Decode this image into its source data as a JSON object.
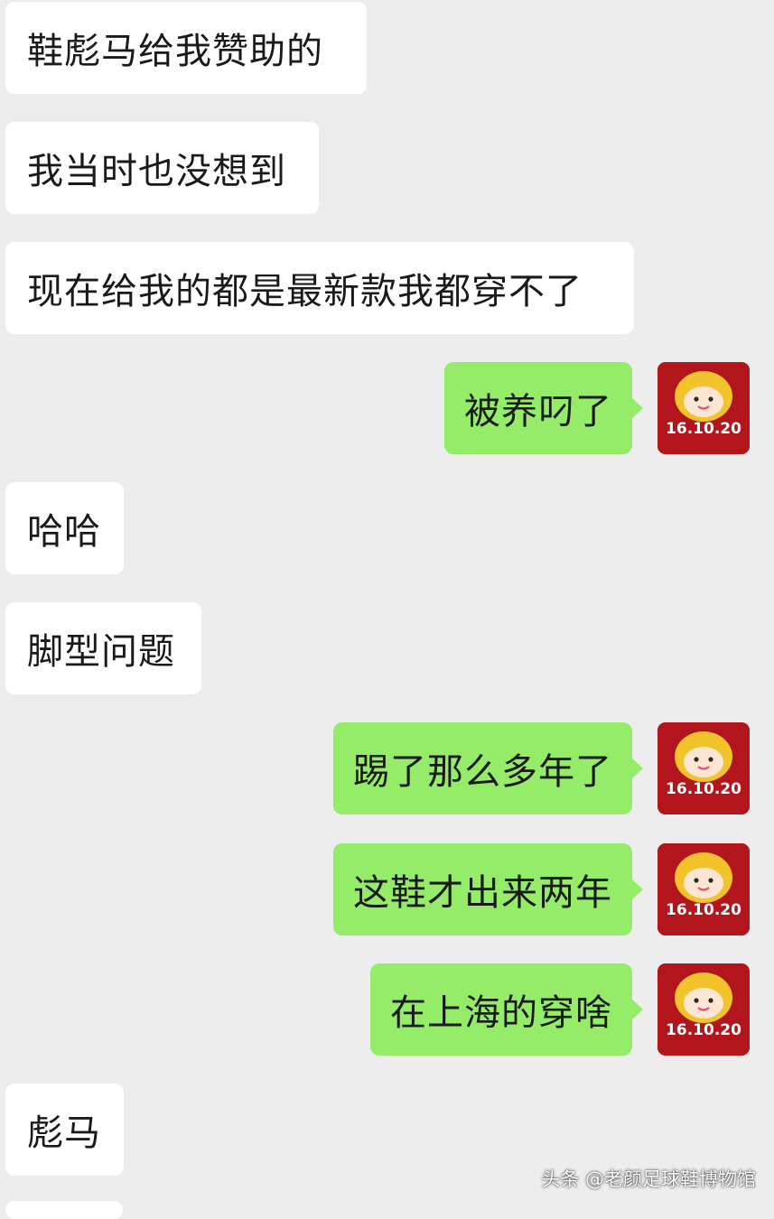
{
  "chat": {
    "messages": [
      {
        "side": "in",
        "text": "鞋彪马给我赞助的"
      },
      {
        "side": "in",
        "text": "我当时也没想到"
      },
      {
        "side": "in",
        "text": "现在给我的都是最新款我都穿不了"
      },
      {
        "side": "out",
        "text": "被养叼了"
      },
      {
        "side": "in",
        "text": "哈哈"
      },
      {
        "side": "in",
        "text": "脚型问题"
      },
      {
        "side": "out",
        "text": "踢了那么多年了"
      },
      {
        "side": "out",
        "text": "这鞋才出来两年"
      },
      {
        "side": "out",
        "text": "在上海的穿啥"
      },
      {
        "side": "in",
        "text": "彪马"
      }
    ]
  },
  "avatar": {
    "date_text": "16.10.20",
    "icon": "cartoon-face-avatar-icon",
    "background_color": "#b3151d",
    "hair_color": "#f2c32b"
  },
  "colors": {
    "background": "#ededed",
    "incoming_bubble": "#ffffff",
    "outgoing_bubble": "#95ec69"
  },
  "watermark": {
    "text": "头条 @老颜足球鞋博物馆"
  }
}
